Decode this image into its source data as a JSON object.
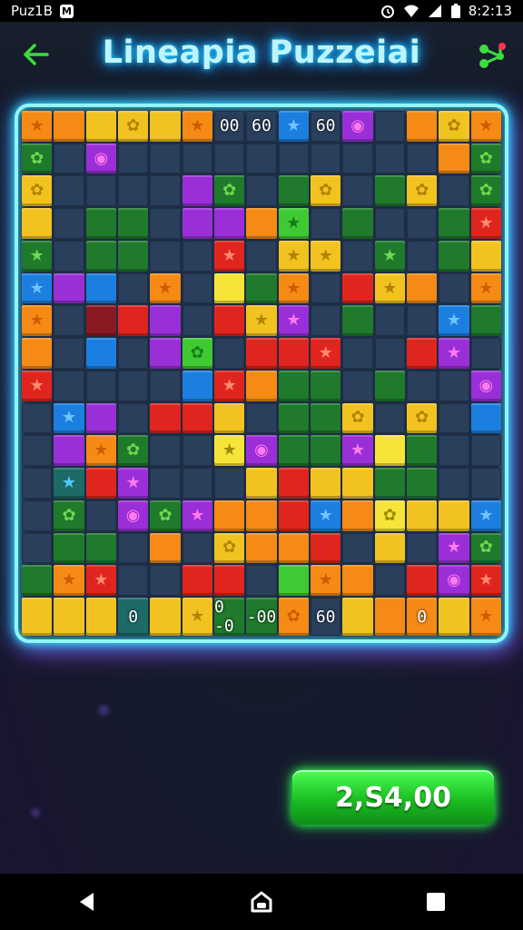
{
  "status_bar": {
    "app_label": "Puz1B",
    "time": "8:2:13"
  },
  "header": {
    "title": "Lineapia Puzzeiai",
    "back_icon": "arrow-left-icon",
    "share_icon": "share-icon"
  },
  "board": {
    "rows": [
      [
        "o-star",
        "o",
        "y",
        "y-clover",
        "y",
        "o-star",
        "n:00",
        "n:60",
        "b-star",
        "n:60",
        "p-dot",
        "n",
        "o",
        "y-clover",
        "o-star"
      ],
      [
        "g-clover",
        "n",
        "p-dot",
        "n",
        "n",
        "n",
        "n",
        "n",
        "n",
        "n",
        "n",
        "n",
        "n",
        "o",
        "g-clover"
      ],
      [
        "y-clover",
        "n",
        "n",
        "n",
        "n",
        "p",
        "g-clover",
        "n",
        "g",
        "y-clover",
        "n",
        "g",
        "y-clover",
        "n",
        "g-clover"
      ],
      [
        "y",
        "n",
        "g",
        "g",
        "n",
        "p",
        "p",
        "o",
        "lg-star",
        "n",
        "g",
        "n",
        "n",
        "g",
        "r-star"
      ],
      [
        "g-star",
        "n",
        "g",
        "g",
        "n",
        "n",
        "r-star",
        "n",
        "y-star",
        "y-star",
        "n",
        "g-star",
        "n",
        "g",
        "y"
      ],
      [
        "b-star",
        "p",
        "b",
        "n",
        "o-star",
        "n",
        "ly",
        "g",
        "o-star",
        "n",
        "r",
        "y-star",
        "o",
        "n",
        "o-star"
      ],
      [
        "o-star",
        "n",
        "dr",
        "r",
        "p",
        "n",
        "r",
        "y-star",
        "p-star",
        "n",
        "g",
        "n",
        "n",
        "b-star",
        "g"
      ],
      [
        "o",
        "n",
        "b",
        "n",
        "p",
        "lg-clover",
        "n",
        "r",
        "r",
        "r-star",
        "n",
        "n",
        "r",
        "p-star",
        "n"
      ],
      [
        "r-star",
        "n",
        "n",
        "n",
        "n",
        "b",
        "r-star",
        "o",
        "g",
        "g",
        "n",
        "g",
        "n",
        "n",
        "p-dot"
      ],
      [
        "n",
        "b-star",
        "p",
        "n",
        "r",
        "r",
        "y",
        "n",
        "g",
        "g",
        "y-clover",
        "n",
        "y-clover",
        "n",
        "b"
      ],
      [
        "n",
        "p",
        "o-star",
        "g-clover",
        "n",
        "n",
        "ly-star",
        "p-dot",
        "g",
        "g",
        "p-star",
        "ly",
        "g",
        "n",
        "n"
      ],
      [
        "n",
        "t-star",
        "r",
        "p-star",
        "n",
        "n",
        "n",
        "y",
        "r",
        "y",
        "y",
        "g",
        "g",
        "n",
        "n"
      ],
      [
        "n",
        "g-clover",
        "n",
        "p-dot",
        "g-clover",
        "p-star",
        "o",
        "o",
        "r",
        "b-star",
        "o",
        "ly-clover",
        "y",
        "y",
        "b-star"
      ],
      [
        "n",
        "g",
        "g",
        "n",
        "o",
        "n",
        "y-clover",
        "o",
        "o",
        "r",
        "n",
        "y",
        "n",
        "p-star",
        "g-clover"
      ],
      [
        "g",
        "o-star",
        "r-star",
        "n",
        "n",
        "r",
        "r",
        "n",
        "lg",
        "o-star",
        "o",
        "n",
        "r",
        "p-dot",
        "r-star"
      ],
      [
        "y",
        "y",
        "y",
        "t:0",
        "y",
        "y-star",
        "g:0 -0",
        "g:-00",
        "o-clover",
        "n:60",
        "y",
        "o",
        "o:0",
        "y",
        "o-star"
      ]
    ]
  },
  "score": {
    "value": "2,S4,00"
  },
  "nav": {
    "back_icon": "nav-back-icon",
    "home_icon": "nav-home-icon",
    "recents_icon": "nav-recents-icon"
  },
  "colors": {
    "accent_cyan": "#3fe7ff",
    "accent_green": "#2aff4a",
    "background": "#141c2c"
  }
}
